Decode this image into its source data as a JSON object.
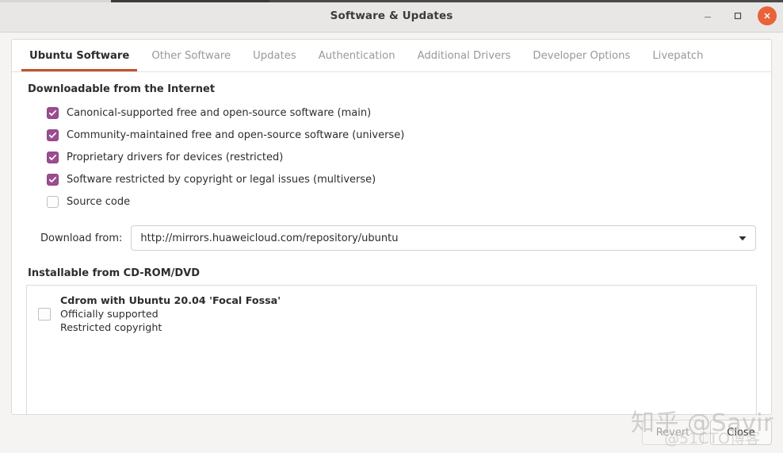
{
  "window": {
    "title": "Software & Updates",
    "controls": {
      "minimize": "minimize",
      "maximize": "maximize",
      "close": "close"
    }
  },
  "tabs": [
    {
      "label": "Ubuntu Software",
      "active": true
    },
    {
      "label": "Other Software",
      "active": false
    },
    {
      "label": "Updates",
      "active": false
    },
    {
      "label": "Authentication",
      "active": false
    },
    {
      "label": "Additional Drivers",
      "active": false
    },
    {
      "label": "Developer Options",
      "active": false
    },
    {
      "label": "Livepatch",
      "active": false
    }
  ],
  "internet_section": {
    "title": "Downloadable from the Internet",
    "options": [
      {
        "label": "Canonical-supported free and open-source software (main)",
        "checked": true
      },
      {
        "label": "Community-maintained free and open-source software (universe)",
        "checked": true
      },
      {
        "label": "Proprietary drivers for devices (restricted)",
        "checked": true
      },
      {
        "label": "Software restricted by copyright or legal issues (multiverse)",
        "checked": true
      },
      {
        "label": "Source code",
        "checked": false
      }
    ],
    "download_from": {
      "label": "Download from:",
      "value": "http://mirrors.huaweicloud.com/repository/ubuntu"
    }
  },
  "cdrom_section": {
    "title": "Installable from CD-ROM/DVD",
    "items": [
      {
        "checked": false,
        "line1": "Cdrom with Ubuntu 20.04 'Focal Fossa'",
        "line2": "Officially supported",
        "line3": "Restricted copyright"
      }
    ]
  },
  "footer": {
    "revert_label": "Revert",
    "revert_disabled": true,
    "close_label": "Close"
  },
  "watermark": {
    "main": "知乎 @Savir",
    "sub": "@51CTO博客"
  },
  "colors": {
    "accent_orange": "#c4512a",
    "checkbox_purple": "#9b4d91",
    "close_button": "#e8633a",
    "titlebar_bg": "#e9e7e5",
    "panel_bg": "#ffffff",
    "window_bg": "#f5f4f3"
  }
}
